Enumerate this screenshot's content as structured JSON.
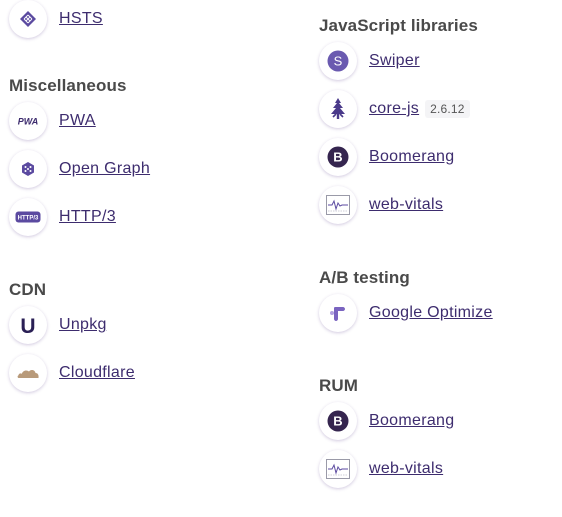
{
  "left_column": {
    "top_item": {
      "label": "HSTS",
      "icon": "hsts-icon"
    },
    "miscellaneous": {
      "heading": "Miscellaneous",
      "items": [
        {
          "label": "PWA",
          "icon": "pwa-icon",
          "icon_text": "PWA"
        },
        {
          "label": "Open Graph",
          "icon": "open-graph-icon"
        },
        {
          "label": "HTTP/3",
          "icon": "http3-icon",
          "icon_text": "HTTP/3"
        }
      ]
    },
    "cdn": {
      "heading": "CDN",
      "items": [
        {
          "label": "Unpkg",
          "icon": "unpkg-icon",
          "icon_text": "U"
        },
        {
          "label": "Cloudflare",
          "icon": "cloudflare-icon"
        }
      ]
    }
  },
  "right_column": {
    "javascript_libraries": {
      "heading": "JavaScript libraries",
      "items": [
        {
          "label": "Swiper",
          "icon": "swiper-icon",
          "icon_text": "S"
        },
        {
          "label": "core-js",
          "version": "2.6.12",
          "icon": "core-js-icon"
        },
        {
          "label": "Boomerang",
          "icon": "boomerang-icon",
          "icon_text": "B"
        },
        {
          "label": "web-vitals",
          "icon": "web-vitals-icon"
        }
      ]
    },
    "ab_testing": {
      "heading": "A/B testing",
      "items": [
        {
          "label": "Google Optimize",
          "icon": "google-optimize-icon"
        }
      ]
    },
    "rum": {
      "heading": "RUM",
      "items": [
        {
          "label": "Boomerang",
          "icon": "boomerang-icon",
          "icon_text": "B"
        },
        {
          "label": "web-vitals",
          "icon": "web-vitals-icon"
        }
      ]
    }
  },
  "colors": {
    "link": "#3d2c6e",
    "heading": "#4a4a4a",
    "brand_purple": "#5b4aa0",
    "boomerang": "#35254f",
    "cloudflare": "#b89a7a"
  }
}
